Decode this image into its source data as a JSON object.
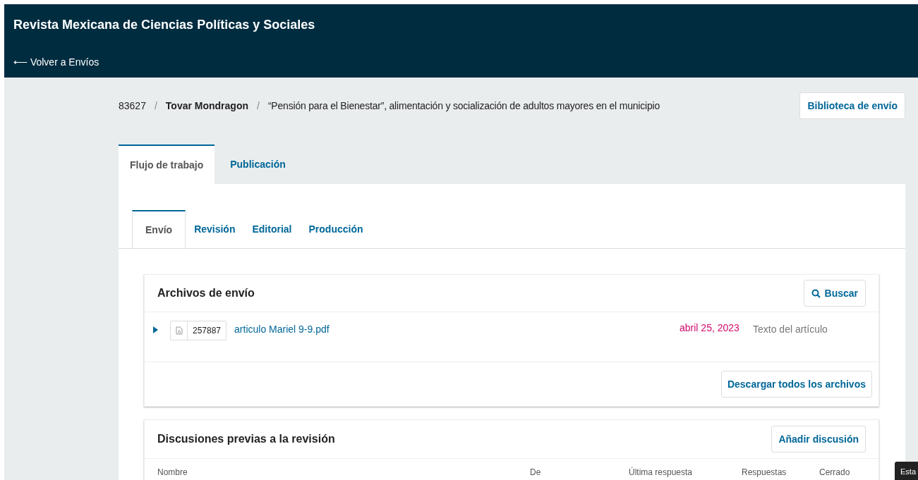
{
  "header": {
    "title": "Revista Mexicana de Ciencias Políticas y Sociales",
    "back_link": "⟵ Volver a Envíos"
  },
  "breadcrumb": {
    "id": "83627",
    "separator_1": "/",
    "author": "Tovar Mondragon",
    "separator_2": "/",
    "title": "“Pensión para el Bienestar”, alimentación y socialización de adultos mayores en el municipio"
  },
  "library_button": "Biblioteca de envío",
  "tabs": [
    {
      "label": "Flujo de trabajo",
      "selected": true
    },
    {
      "label": "Publicación",
      "selected": false
    }
  ],
  "stage_tabs": [
    {
      "label": "Envío",
      "selected": true
    },
    {
      "label": "Revisión",
      "selected": false
    },
    {
      "label": "Editorial",
      "selected": false
    },
    {
      "label": "Producción",
      "selected": false
    }
  ],
  "files_panel": {
    "title": "Archivos de envío",
    "search_button": "Buscar",
    "files": [
      {
        "id": "257887",
        "name": "articulo Mariel 9-9.pdf",
        "date": "abril 25, 2023",
        "type": "Texto del artículo",
        "expanded": false
      }
    ],
    "download_button": "Descargar todos los archivos"
  },
  "discussions_panel": {
    "title": "Discusiones previas a la revisión",
    "add_button": "Añadir discusión",
    "columns": [
      "Nombre",
      "De",
      "Última respuesta",
      "Respuestas",
      "Cerrado"
    ]
  },
  "tooltip": "Esta"
}
